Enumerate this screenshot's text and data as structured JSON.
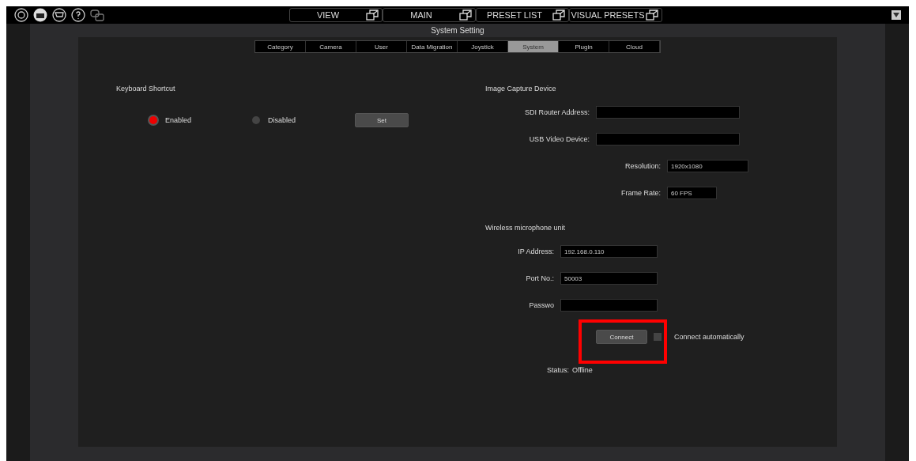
{
  "toolbar": {
    "tabs": [
      {
        "label": "VIEW"
      },
      {
        "label": "MAIN"
      },
      {
        "label": "PRESET LIST"
      },
      {
        "label": "VISUAL PRESETS"
      }
    ]
  },
  "window": {
    "title": "System Setting"
  },
  "tabs": [
    {
      "label": "Category",
      "selected": false
    },
    {
      "label": "Camera",
      "selected": false
    },
    {
      "label": "User",
      "selected": false
    },
    {
      "label": "Data Migration",
      "selected": false
    },
    {
      "label": "Joystick",
      "selected": false
    },
    {
      "label": "System",
      "selected": true
    },
    {
      "label": "Plugin",
      "selected": false
    },
    {
      "label": "Cloud",
      "selected": false
    }
  ],
  "keyboard_shortcut": {
    "heading": "Keyboard Shortcut",
    "options": [
      {
        "label": "Enabled",
        "selected": true
      },
      {
        "label": "Disabled",
        "selected": false
      }
    ],
    "button": "Set"
  },
  "image_capture": {
    "heading": "Image Capture Device",
    "fields": [
      {
        "kind": "wide",
        "label": "SDI Router Address:"
      },
      {
        "kind": "wide",
        "label": "USB Video Device:"
      },
      {
        "kind": "medium",
        "label": "Resolution:",
        "value": "1920x1080"
      },
      {
        "kind": "short",
        "label": "Frame Rate:",
        "value": "60 FPS"
      }
    ]
  },
  "microphone": {
    "heading": "Wireless microphone unit",
    "fields": [
      {
        "label": "IP Address:",
        "value": "192.168.0.110"
      },
      {
        "label": "Port No.:",
        "value": "50003"
      },
      {
        "label": "Passwo"
      }
    ],
    "button": "Connect",
    "auto_connect": {
      "label": "Connect automatically",
      "checked": false
    },
    "status_label": "Status:",
    "status": "Offline",
    "highlight": true
  }
}
